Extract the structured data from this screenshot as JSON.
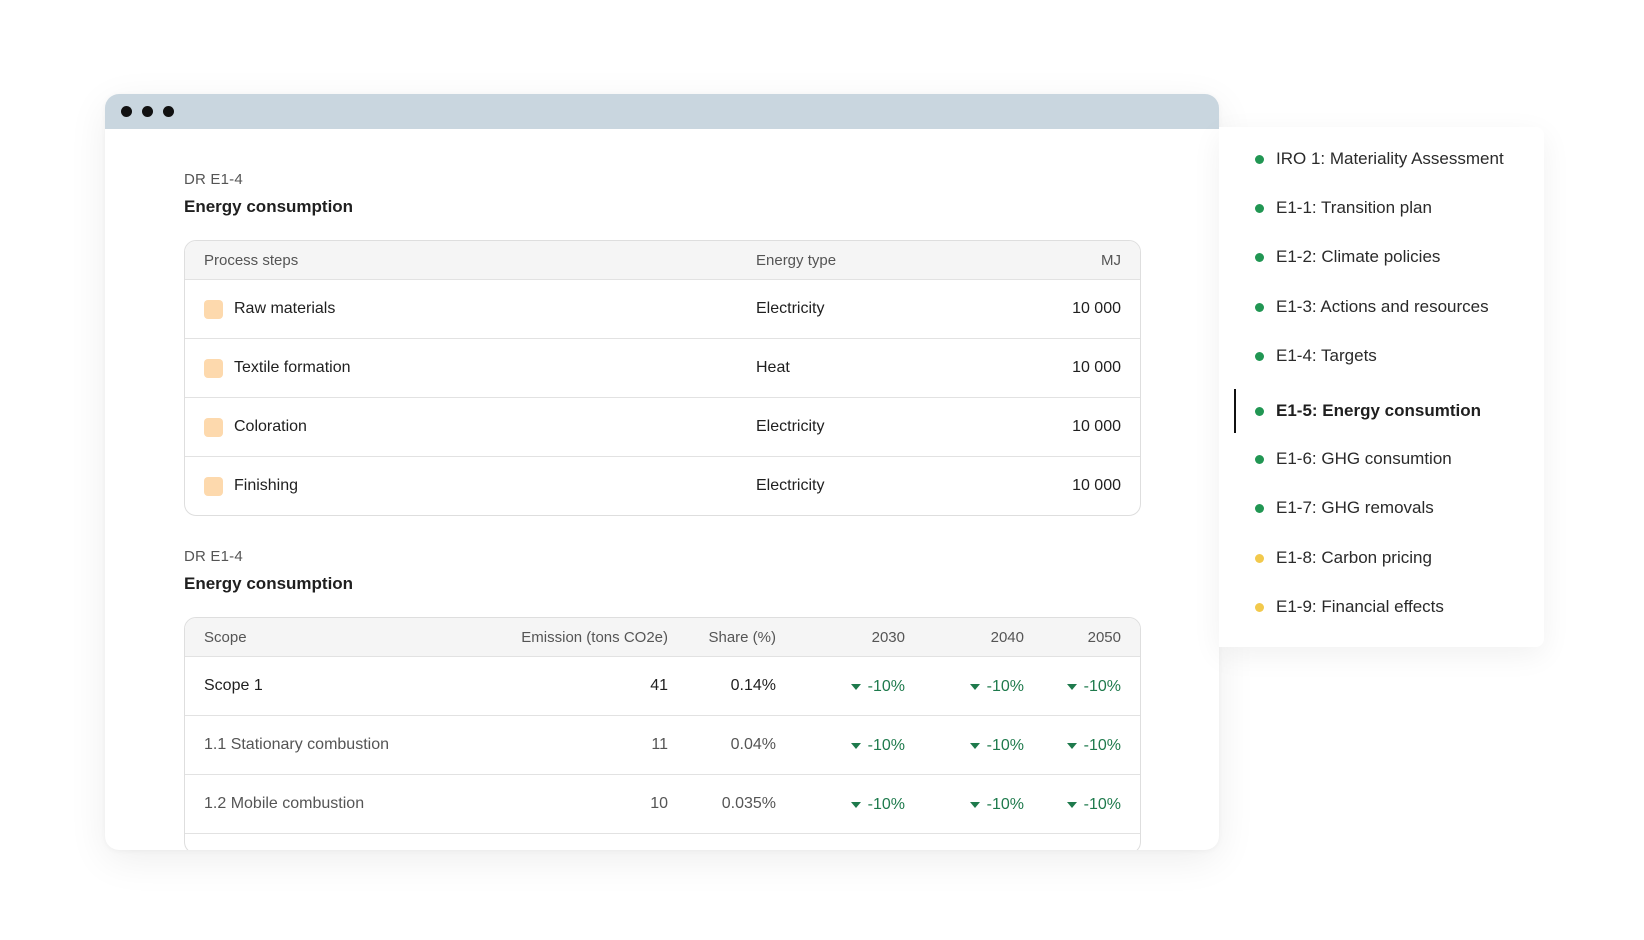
{
  "window": {},
  "section1": {
    "code": "DR E1-4",
    "title": "Energy consumption",
    "headers": [
      "Process steps",
      "Energy type",
      "MJ"
    ],
    "rows": [
      {
        "step": "Raw materials",
        "type": "Electricity",
        "mj": "10 000"
      },
      {
        "step": "Textile formation",
        "type": "Heat",
        "mj": "10 000"
      },
      {
        "step": "Coloration",
        "type": "Electricity",
        "mj": "10 000"
      },
      {
        "step": "Finishing",
        "type": "Electricity",
        "mj": "10 000"
      }
    ],
    "swatch_color": "#fdd9ad"
  },
  "section2": {
    "code": "DR E1-4",
    "title": "Energy consumption",
    "headers": [
      "Scope",
      "Emission (tons CO2e)",
      "Share (%)",
      "2030",
      "2040",
      "2050"
    ],
    "rows": [
      {
        "scope": "Scope 1",
        "emission": "41",
        "share": "0.14%",
        "y2030": "-10%",
        "y2040": "-10%",
        "y2050": "-10%"
      },
      {
        "scope": "1.1 Stationary combustion",
        "emission": "11",
        "share": "0.04%",
        "y2030": "-10%",
        "y2040": "-10%",
        "y2050": "-10%"
      },
      {
        "scope": "1.2 Mobile combustion",
        "emission": "10",
        "share": "0.035%",
        "y2030": "-10%",
        "y2040": "-10%",
        "y2050": "-10%"
      }
    ],
    "trend_color": "#1e7a4c"
  },
  "nav": {
    "items": [
      {
        "label": "IRO 1: Materiality Assessment",
        "status_color": "#219653"
      },
      {
        "label": "E1-1: Transition plan",
        "status_color": "#219653"
      },
      {
        "label": "E1-2: Climate policies",
        "status_color": "#219653"
      },
      {
        "label": "E1-3: Actions and resources",
        "status_color": "#219653"
      },
      {
        "label": "E1-4: Targets",
        "status_color": "#219653"
      },
      {
        "label": "E1-5: Energy consumtion",
        "status_color": "#219653"
      },
      {
        "label": "E1-6: GHG consumtion",
        "status_color": "#219653"
      },
      {
        "label": "E1-7: GHG removals",
        "status_color": "#219653"
      },
      {
        "label": "E1-8: Carbon pricing",
        "status_color": "#f2c94c"
      },
      {
        "label": "E1-9: Financial effects",
        "status_color": "#f2c94c"
      }
    ],
    "active_label": "E1-5: Energy consumtion"
  }
}
